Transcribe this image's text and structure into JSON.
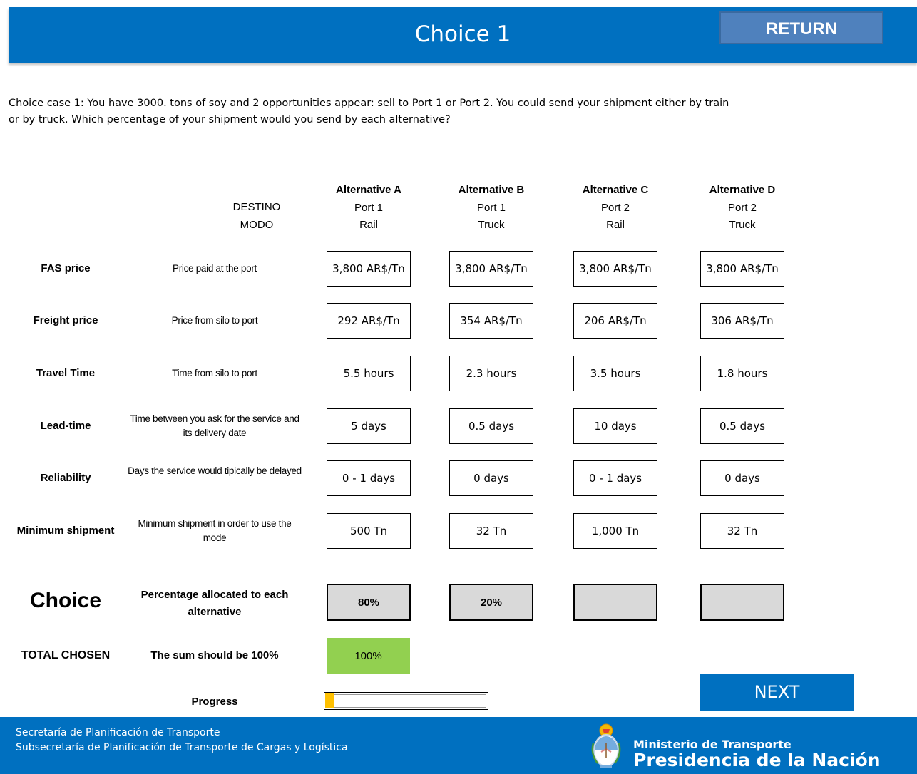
{
  "header": {
    "title": "Choice 1",
    "return_label": "RETURN"
  },
  "intro": {
    "line1": "Choice case 1: You have 3000. tons of soy and 2 opportunities appear: sell to Port 1 or Port 2. You could send your shipment either by train",
    "line2": "or by truck. Which percentage of your shipment would you send by each alternative?"
  },
  "labels": {
    "destino": "DESTINO",
    "modo": "MODO"
  },
  "alternatives": [
    {
      "name": "Alternative A",
      "port": "Port 1",
      "mode": "Rail"
    },
    {
      "name": "Alternative B",
      "port": "Port 1",
      "mode": "Truck"
    },
    {
      "name": "Alternative C",
      "port": "Port 2",
      "mode": "Rail"
    },
    {
      "name": "Alternative D",
      "port": "Port 2",
      "mode": "Truck"
    }
  ],
  "attributes": [
    {
      "label": "FAS price",
      "desc": "Price paid at the port",
      "values": [
        "3,800 AR$/Tn",
        "3,800 AR$/Tn",
        "3,800 AR$/Tn",
        "3,800 AR$/Tn"
      ]
    },
    {
      "label": "Freight price",
      "desc": "Price from silo to port",
      "values": [
        "292 AR$/Tn",
        "354 AR$/Tn",
        "206 AR$/Tn",
        "306 AR$/Tn"
      ]
    },
    {
      "label": "Travel Time",
      "desc": "Time from silo to port",
      "values": [
        "5.5 hours",
        "2.3 hours",
        "3.5 hours",
        "1.8 hours"
      ]
    },
    {
      "label": "Lead-time",
      "desc": "Time between you ask for the service and its delivery date",
      "values": [
        "5 days",
        "0.5 days",
        "10 days",
        "0.5 days"
      ]
    },
    {
      "label": "Reliability",
      "desc": "Days the service would tipically be delayed",
      "values": [
        "0 - 1 days",
        "0 days",
        "0 - 1 days",
        "0 days"
      ]
    },
    {
      "label": "Minimum shipment",
      "desc": "Minimum shipment in order to use the mode",
      "values": [
        "500 Tn",
        "32 Tn",
        "1,000 Tn",
        "32 Tn"
      ]
    }
  ],
  "choice": {
    "title": "Choice",
    "desc": "Percentage allocated to each alternative",
    "values": [
      "80%",
      "20%",
      "",
      ""
    ]
  },
  "total": {
    "label": "TOTAL CHOSEN",
    "desc": "The sum should be 100%",
    "value": "100%"
  },
  "progress": {
    "label": "Progress",
    "fraction": 0.03
  },
  "next_label": "NEXT",
  "footer": {
    "line1": "Secretaría de Planificación de Transporte",
    "line2": "Subsecretaría de Planificación de Transporte de Cargas y Logística",
    "ministry": "Ministerio de Transporte",
    "presidencia": "Presidencia de la Nación"
  },
  "colors": {
    "brand_blue": "#0070c0",
    "return_blue": "#4f81bd",
    "total_green": "#92d050",
    "progress_yellow": "#ffc000",
    "choice_gray": "#d9d9d9"
  },
  "icons": {
    "seal": "argentina-coat-of-arms-icon"
  }
}
